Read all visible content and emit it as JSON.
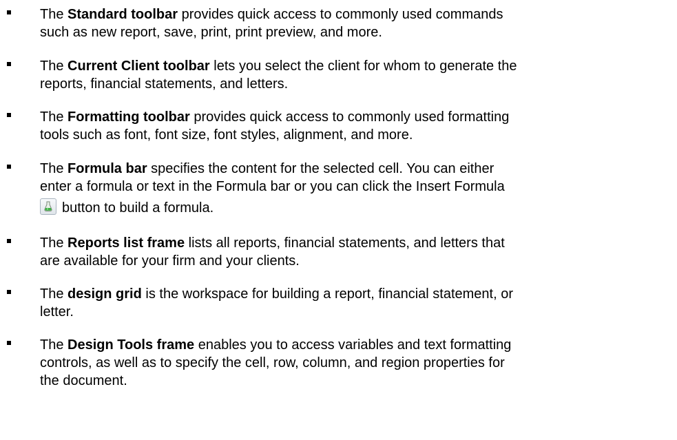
{
  "items": [
    {
      "term": "Standard toolbar",
      "line1": " provides quick access to commonly used commands",
      "line2": "such as new report, save, print, print preview, and more."
    },
    {
      "term": "Current Client toolbar",
      "line1": " lets you select the client for whom to generate the",
      "line2": "reports, financial statements, and letters."
    },
    {
      "term": "Formatting toolbar",
      "line1": " provides quick access to commonly used formatting",
      "line2": "tools such as font, font size, font styles, alignment, and more."
    },
    {
      "term": "Formula bar",
      "line1": " specifies the content for the selected cell. You can either",
      "line2": "enter a formula or text in the Formula bar or you can click the Insert Formula",
      "line3": "button to build a formula.",
      "icon": "insert-formula-icon"
    },
    {
      "term": "Reports list frame",
      "line1": " lists all reports, financial statements, and letters that",
      "line2": "are available for your firm and your clients."
    },
    {
      "term": "design grid",
      "line1": " is the workspace for building a report, financial statement, or",
      "line2": "letter."
    },
    {
      "term": "Design Tools frame",
      "line1": " enables you to access variables and text formatting",
      "line2": "controls, as well as to specify the cell, row, column, and region properties for",
      "line3": "the document."
    }
  ],
  "lead_word": "The ",
  "colors": {
    "text": "#000000",
    "icon_green": "#3cb043"
  }
}
